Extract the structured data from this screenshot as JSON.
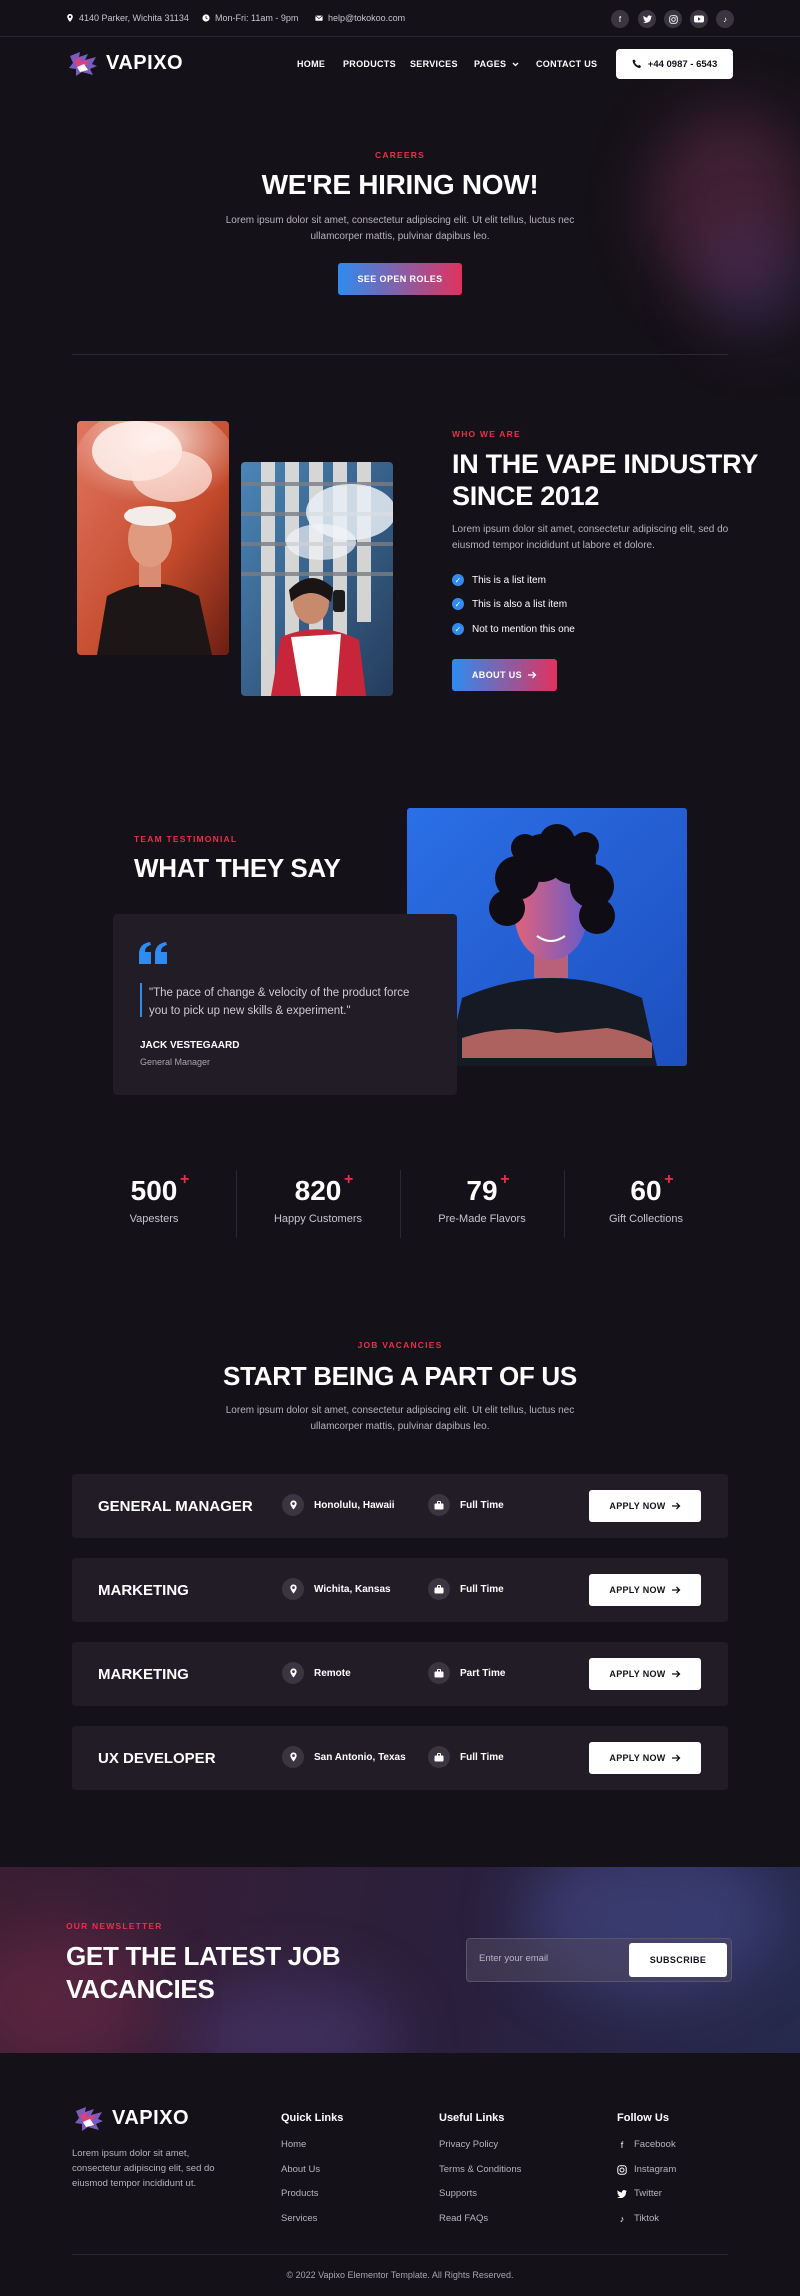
{
  "topbar": {
    "address": "4140 Parker, Wichita 31134",
    "hours": "Mon-Fri: 11am - 9pm",
    "email": "help@tokokoo.com",
    "socials": [
      "facebook-icon",
      "twitter-icon",
      "instagram-icon",
      "youtube-icon",
      "tiktok-icon"
    ]
  },
  "header": {
    "logo": "VAPIXO",
    "nav": [
      "HOME",
      "PRODUCTS",
      "SERVICES",
      "PAGES",
      "CONTACT US"
    ],
    "phone": "+44 0987 - 6543"
  },
  "hero": {
    "eyebrow": "CAREERS",
    "title": "WE'RE HIRING NOW!",
    "text_line1": "Lorem ipsum dolor sit amet, consectetur adipiscing elit. Ut elit tellus, luctus nec",
    "text_line2": "ullamcorper mattis, pulvinar dapibus leo.",
    "button": "SEE OPEN ROLES"
  },
  "about": {
    "eyebrow": "WHO WE ARE",
    "title_line1": "IN THE VAPE INDUSTRY",
    "title_line2": "SINCE 2012",
    "text_line1": "Lorem ipsum dolor sit amet, consectetur adipiscing elit, sed do",
    "text_line2": "eiusmod tempor incididunt ut labore et dolore.",
    "list": [
      "This is a list item",
      "This is also a list item",
      "Not to mention this one"
    ],
    "button": "ABOUT US"
  },
  "testimonial": {
    "eyebrow": "TEAM TESTIMONIAL",
    "title": "WHAT THEY SAY",
    "quote_line1": "\"The pace of change & velocity of the product force",
    "quote_line2": "you to pick up new skills & experiment.\"",
    "name": "JACK VESTEGAARD",
    "role": "General Manager"
  },
  "stats": [
    {
      "value": "500",
      "label": "Vapesters"
    },
    {
      "value": "820",
      "label": "Happy Customers"
    },
    {
      "value": "79",
      "label": "Pre-Made Flavors"
    },
    {
      "value": "60",
      "label": "Gift Collections"
    }
  ],
  "vacancies": {
    "eyebrow": "JOB VACANCIES",
    "title": "START BEING A PART OF US",
    "text_line1": "Lorem ipsum dolor sit amet, consectetur adipiscing elit. Ut elit tellus, luctus nec",
    "text_line2": "ullamcorper mattis, pulvinar dapibus leo.",
    "apply_label": "APPLY NOW",
    "jobs": [
      {
        "title": "GENERAL MANAGER",
        "location": "Honolulu, Hawaii",
        "type": "Full Time"
      },
      {
        "title": "MARKETING",
        "location": "Wichita, Kansas",
        "type": "Full Time"
      },
      {
        "title": "MARKETING",
        "location": "Remote",
        "type": "Part Time"
      },
      {
        "title": "UX DEVELOPER",
        "location": "San Antonio, Texas",
        "type": "Full Time"
      }
    ]
  },
  "newsletter": {
    "eyebrow": "OUR NEWSLETTER",
    "title_line1": "GET THE LATEST JOB",
    "title_line2": "VACANCIES",
    "placeholder": "Enter your email",
    "button": "SUBSCRIBE"
  },
  "footer": {
    "logo": "VAPIXO",
    "about_line1": "Lorem ipsum dolor sit amet,",
    "about_line2": "consectetur adipiscing elit, sed do",
    "about_line3": "eiusmod tempor incididunt ut.",
    "quick_links_title": "Quick Links",
    "quick_links": [
      "Home",
      "About Us",
      "Products",
      "Services"
    ],
    "useful_links_title": "Useful Links",
    "useful_links": [
      "Privacy Policy",
      "Terms & Conditions",
      "Supports",
      "Read FAQs"
    ],
    "follow_title": "Follow Us",
    "follow_links": [
      "Facebook",
      "Instagram",
      "Twitter",
      "Tiktok"
    ],
    "copyright": "© 2022 Vapixo Elementor Template. All Rights Reserved."
  },
  "colors": {
    "background": "#151118",
    "card": "#221c27",
    "accent_red": "#e8304a",
    "accent_blue": "#2f8bf0"
  }
}
